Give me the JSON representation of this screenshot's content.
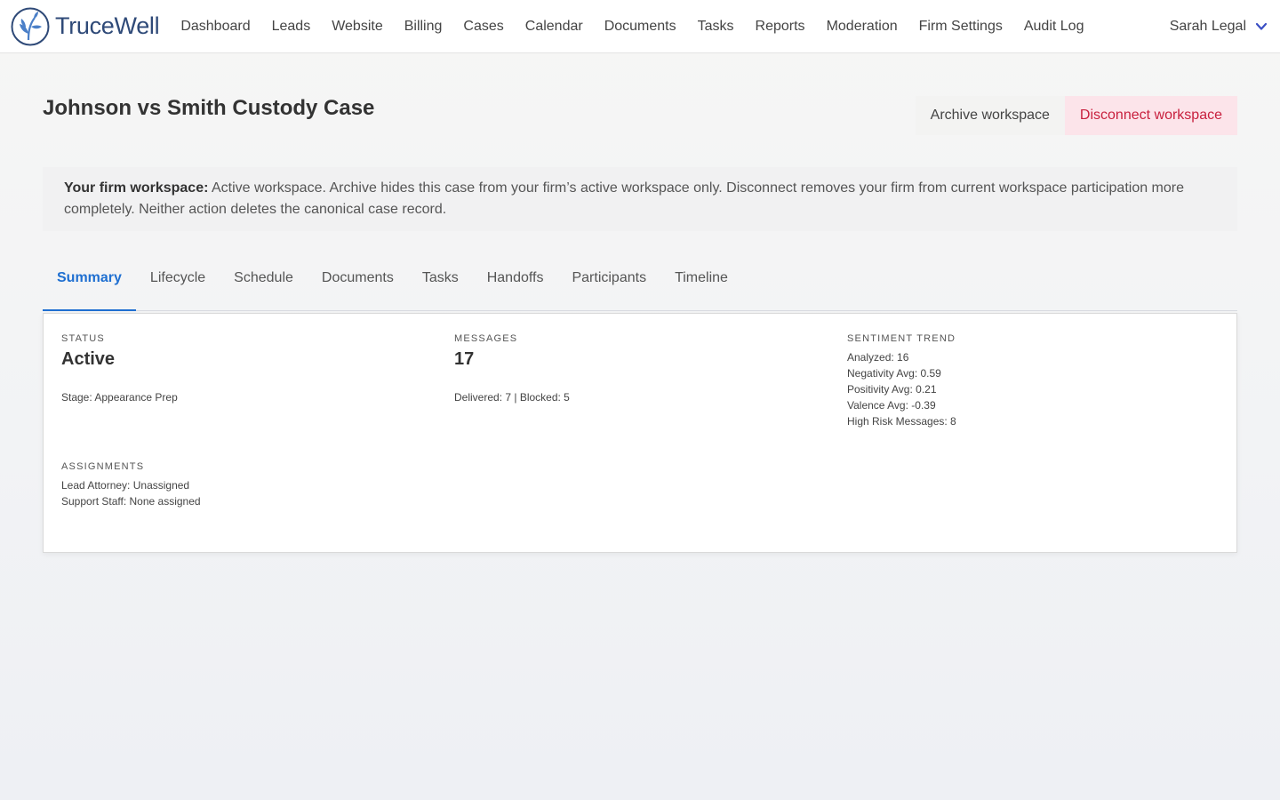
{
  "brand": {
    "name": "TruceWell",
    "logo_icon": "leaf-sprout-icon",
    "accent": "#2f4a78"
  },
  "nav": {
    "items": [
      "Dashboard",
      "Leads",
      "Website",
      "Billing",
      "Cases",
      "Calendar",
      "Documents",
      "Tasks",
      "Reports",
      "Moderation",
      "Firm Settings",
      "Audit Log"
    ]
  },
  "user": {
    "name": "Sarah Legal",
    "menu_icon": "chevron-down-icon"
  },
  "page": {
    "title": "Johnson vs Smith Custody Case",
    "archive_label": "Archive workspace",
    "disconnect_label": "Disconnect workspace"
  },
  "notice": {
    "lead": "Your firm workspace:",
    "text": " Active workspace. Archive hides this case from your firm’s active workspace only. Disconnect removes your firm from current workspace participation more completely. Neither action deletes the canonical case record."
  },
  "tabs": [
    "Summary",
    "Lifecycle",
    "Schedule",
    "Documents",
    "Tasks",
    "Handoffs",
    "Participants",
    "Timeline"
  ],
  "active_tab": "Summary",
  "summary": {
    "status": {
      "label": "Status",
      "value": "Active",
      "stage": "Stage: Appearance Prep"
    },
    "messages": {
      "label": "Messages",
      "value": "17",
      "detail": "Delivered: 7 | Blocked: 5"
    },
    "sentiment": {
      "label": "Sentiment Trend",
      "lines": [
        "Analyzed: 16",
        "Negativity Avg: 0.59",
        "Positivity Avg: 0.21",
        "Valence Avg: -0.39",
        "High Risk Messages: 8"
      ]
    },
    "assignments": {
      "label": "Assignments",
      "lines": [
        "Lead Attorney: Unassigned",
        "Support Staff: None assigned"
      ]
    }
  },
  "colors": {
    "tab_active": "#1f6fd1",
    "danger": "#c8203e",
    "danger_bg": "#fce4ea"
  }
}
